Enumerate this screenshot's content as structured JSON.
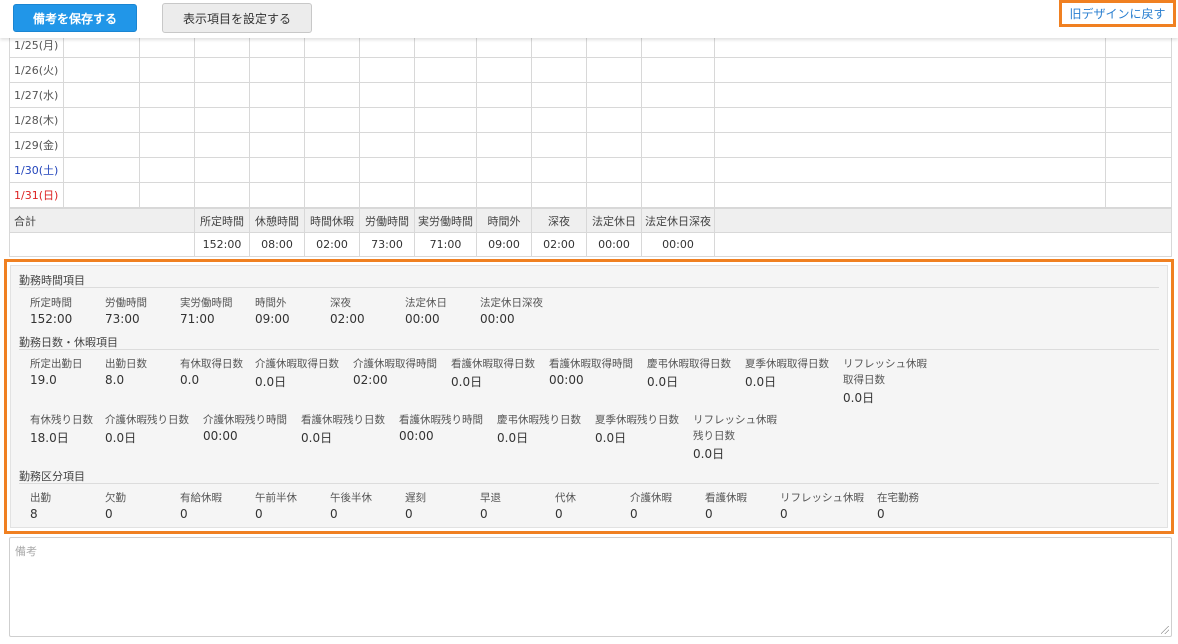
{
  "toolbar": {
    "save_label": "備考を保存する",
    "columns_label": "表示項目を設定する",
    "old_design_label": "旧デザインに戻す"
  },
  "days": [
    {
      "date": "1/25(月)",
      "kind": "weekday"
    },
    {
      "date": "1/26(火)",
      "kind": "weekday"
    },
    {
      "date": "1/27(水)",
      "kind": "weekday"
    },
    {
      "date": "1/28(木)",
      "kind": "weekday"
    },
    {
      "date": "1/29(金)",
      "kind": "weekday"
    },
    {
      "date": "1/30(土)",
      "kind": "saturday"
    },
    {
      "date": "1/31(日)",
      "kind": "sunday"
    }
  ],
  "totals": {
    "label": "合計",
    "headers": [
      "所定時間",
      "休憩時間",
      "時間休暇",
      "労働時間",
      "実労働時間",
      "時間外",
      "深夜",
      "法定休日",
      "法定休日深夜"
    ],
    "values": [
      "152:00",
      "08:00",
      "02:00",
      "73:00",
      "71:00",
      "09:00",
      "02:00",
      "00:00",
      "00:00"
    ]
  },
  "summary": {
    "work_time": {
      "title": "勤務時間項目",
      "items": [
        {
          "label": "所定時間",
          "value": "152:00"
        },
        {
          "label": "労働時間",
          "value": "73:00"
        },
        {
          "label": "実労働時間",
          "value": "71:00"
        },
        {
          "label": "時間外",
          "value": "09:00"
        },
        {
          "label": "深夜",
          "value": "02:00"
        },
        {
          "label": "法定休日",
          "value": "00:00"
        },
        {
          "label": "法定休日深夜",
          "value": "00:00"
        }
      ]
    },
    "days_leave": {
      "title": "勤務日数・休暇項目",
      "row1": [
        {
          "label": "所定出勤日",
          "value": "19.0"
        },
        {
          "label": "出勤日数",
          "value": "8.0"
        },
        {
          "label": "有休取得日数",
          "value": "0.0"
        },
        {
          "label": "介護休暇取得日数",
          "value": "0.0日"
        },
        {
          "label": "介護休暇取得時間",
          "value": "02:00"
        },
        {
          "label": "看護休暇取得日数",
          "value": "0.0日"
        },
        {
          "label": "看護休暇取得時間",
          "value": "00:00"
        },
        {
          "label": "慶弔休暇取得日数",
          "value": "0.0日"
        },
        {
          "label": "夏季休暇取得日数",
          "value": "0.0日"
        },
        {
          "label": "リフレッシュ休暇",
          "label2": "取得日数",
          "value": "0.0日"
        }
      ],
      "row2": [
        {
          "label": "有休残り日数",
          "value": "18.0日"
        },
        {
          "label": "介護休暇残り日数",
          "value": "0.0日"
        },
        {
          "label": "介護休暇残り時間",
          "value": "00:00"
        },
        {
          "label": "看護休暇残り日数",
          "value": "0.0日"
        },
        {
          "label": "看護休暇残り時間",
          "value": "00:00"
        },
        {
          "label": "慶弔休暇残り日数",
          "value": "0.0日"
        },
        {
          "label": "夏季休暇残り日数",
          "value": "0.0日"
        },
        {
          "label": "リフレッシュ休暇",
          "label2": "残り日数",
          "value": "0.0日"
        }
      ]
    },
    "category": {
      "title": "勤務区分項目",
      "items": [
        {
          "label": "出勤",
          "value": "8"
        },
        {
          "label": "欠勤",
          "value": "0"
        },
        {
          "label": "有給休暇",
          "value": "0"
        },
        {
          "label": "午前半休",
          "value": "0"
        },
        {
          "label": "午後半休",
          "value": "0"
        },
        {
          "label": "遅刻",
          "value": "0"
        },
        {
          "label": "早退",
          "value": "0"
        },
        {
          "label": "代休",
          "value": "0"
        },
        {
          "label": "介護休暇",
          "value": "0"
        },
        {
          "label": "看護休暇",
          "value": "0"
        },
        {
          "label": "リフレッシュ休暇",
          "value": "0"
        },
        {
          "label": "在宅勤務",
          "value": "0"
        }
      ]
    }
  },
  "memo": {
    "placeholder": "備考",
    "value": ""
  }
}
